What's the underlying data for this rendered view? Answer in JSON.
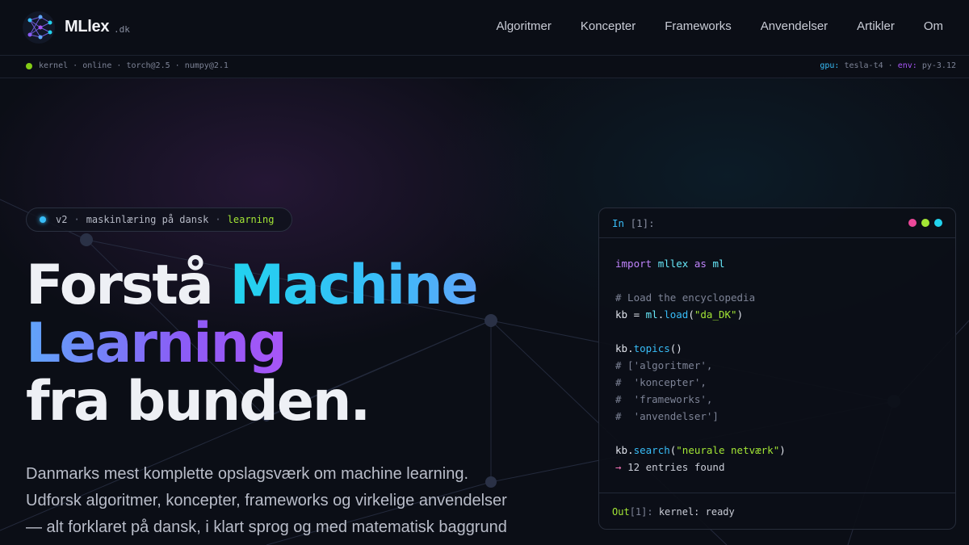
{
  "brand": {
    "name": "MLlex",
    "suffix": ".dk",
    "logo_icon": "neural-network-logo-icon"
  },
  "nav": {
    "items": [
      {
        "label": "Algoritmer"
      },
      {
        "label": "Koncepter"
      },
      {
        "label": "Frameworks"
      },
      {
        "label": "Anvendelser"
      },
      {
        "label": "Artikler"
      },
      {
        "label": "Om"
      }
    ]
  },
  "status": {
    "kernel": "kernel",
    "online": "online",
    "torch": "torch@2.5",
    "numpy": "numpy@2.1",
    "separator": "·",
    "gpu_key": "gpu:",
    "gpu_value": "tesla-t4",
    "env_key": "env:",
    "env_value": "py-3.12",
    "dot_color": "#84cc16"
  },
  "badge": {
    "version": "v2",
    "text": "maskinlæring på dansk",
    "tag": "learning",
    "separator": "·"
  },
  "hero": {
    "line1_plain": "Forstå ",
    "line1_accent": "Machine",
    "line2_accent": "Learning",
    "line3": "fra bunden.",
    "lead_lines": [
      "Danmarks mest komplette opslagsværk om machine learning.",
      "Udforsk algoritmer, koncepter, frameworks og virkelige anvendelser",
      "— alt forklaret på dansk, i klart sprog og med matematisk baggrund"
    ]
  },
  "notebook": {
    "in_label": "In",
    "in_index": "[1]:",
    "window_dots": [
      "#ec4899",
      "#a3e635",
      "#22d3ee"
    ],
    "code": {
      "import_kw": "import",
      "module": "mllex",
      "as_kw": "as",
      "alias": "ml",
      "comment_load": "# Load the encyclopedia",
      "kb_assign": "kb = ",
      "ml_ref": "ml",
      "load_fn": "load",
      "load_arg": "\"da_DK\"",
      "kb": "kb",
      "topics_fn": "topics",
      "topics_comment": [
        "# ['algoritmer',",
        "#  'koncepter',",
        "#  'frameworks',",
        "#  'anvendelser']"
      ],
      "search_fn": "search",
      "search_arg": "\"neurale netværk\"",
      "result_arrow": "→",
      "result_text": "12 entries found"
    },
    "out_label": "Out",
    "out_index": "[1]:",
    "out_text": "kernel: ready"
  },
  "colors": {
    "accent_cyan": "#22d3ee",
    "accent_blue": "#38bdf8",
    "accent_purple": "#a855f7",
    "accent_lime": "#a3e635",
    "background": "#0b0e16"
  }
}
